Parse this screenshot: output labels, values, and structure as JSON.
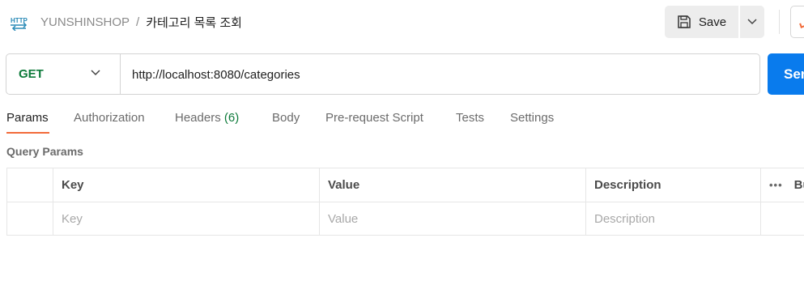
{
  "header": {
    "icon": "http-request-icon",
    "breadcrumb_parent": "YUNSHINSHOP",
    "breadcrumb_separator": "/",
    "breadcrumb_current": "카테고리 목록 조회",
    "save_label": "Save"
  },
  "request": {
    "method": "GET",
    "url": "http://localhost:8080/categories",
    "send_label": "Send"
  },
  "tabs": [
    {
      "label": "Params"
    },
    {
      "label": "Authorization"
    },
    {
      "label": "Headers",
      "count": "(6)"
    },
    {
      "label": "Body"
    },
    {
      "label": "Pre-request Script"
    },
    {
      "label": "Tests"
    },
    {
      "label": "Settings"
    }
  ],
  "params": {
    "section_title": "Query Params",
    "columns": {
      "key": "Key",
      "value": "Value",
      "description": "Description",
      "bulk": "Bulk Edit"
    },
    "placeholders": {
      "key": "Key",
      "value": "Value",
      "description": "Description"
    }
  },
  "colors": {
    "method_get": "#0d7a3a",
    "send_button": "#097bed",
    "active_tab_underline": "#f26b3a"
  }
}
